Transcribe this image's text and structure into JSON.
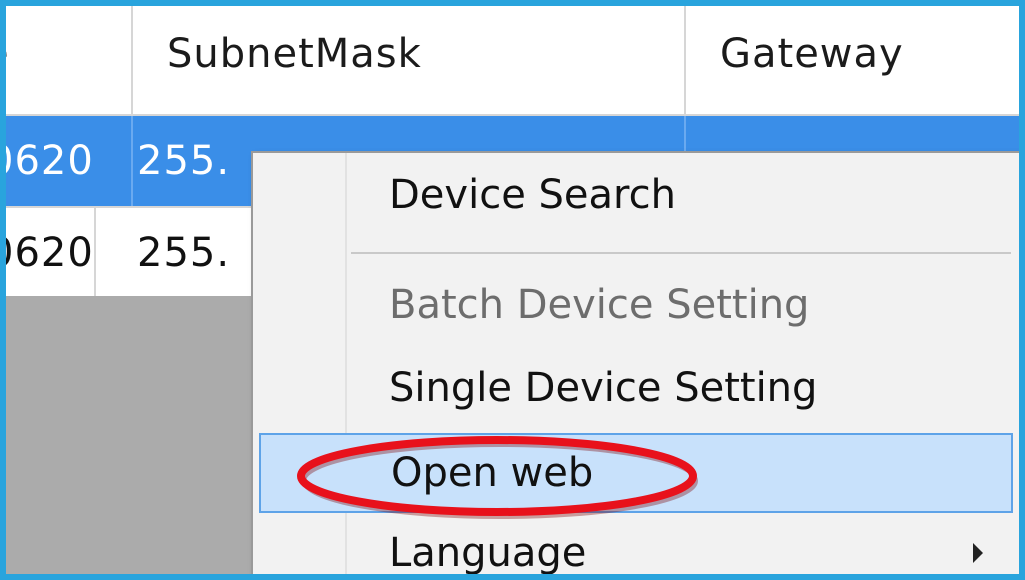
{
  "grid": {
    "headers": {
      "name_partial": "e",
      "subnet_mask": "SubnetMask",
      "gateway": "Gateway"
    },
    "rows": [
      {
        "name_partial": "0620",
        "subnet_partial": "255.",
        "gateway_partial": "",
        "selected": true
      },
      {
        "name_partial": "0620",
        "subnet_partial": "255.",
        "selected": false
      }
    ]
  },
  "context_menu": {
    "items": [
      {
        "label": "Device Search",
        "enabled": true
      },
      {
        "label": "Batch Device Setting",
        "enabled": false
      },
      {
        "label": "Single Device Setting",
        "enabled": true
      },
      {
        "label": "Open web",
        "enabled": true,
        "highlighted": true
      },
      {
        "label": "Language",
        "enabled": true,
        "has_submenu": true
      }
    ]
  },
  "colors": {
    "frame_border": "#29a4dd",
    "selection": "#3a8ee8",
    "menu_hover": "#c8e1fb",
    "annotation": "#e8111b"
  }
}
